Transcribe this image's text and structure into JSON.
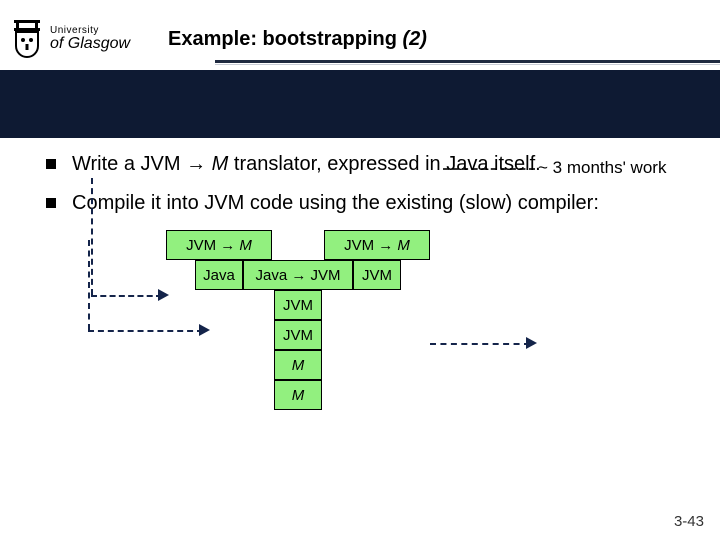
{
  "logo": {
    "line1": "University",
    "line2": "of Glasgow"
  },
  "title_prefix": "Example: bootstrapping ",
  "title_suffix": "(2)",
  "bullets": [
    {
      "plain": "Write a JVM → ",
      "ital": "M",
      "rest": " translator, expressed in Java itself."
    },
    {
      "plain": "Compile it into JVM code using the existing (slow) compiler:"
    }
  ],
  "annotation": "~ 3 months' work",
  "diagram": {
    "tl": {
      "a": "JVM → ",
      "b": "M"
    },
    "tr": {
      "a": "JVM → ",
      "b": "M"
    },
    "ml": "Java",
    "mc": "Java → JVM",
    "mr": "JVM",
    "c1": "JVM",
    "c2": "JVM",
    "b1": "M",
    "b2": "M"
  },
  "pagenum": "3-43"
}
